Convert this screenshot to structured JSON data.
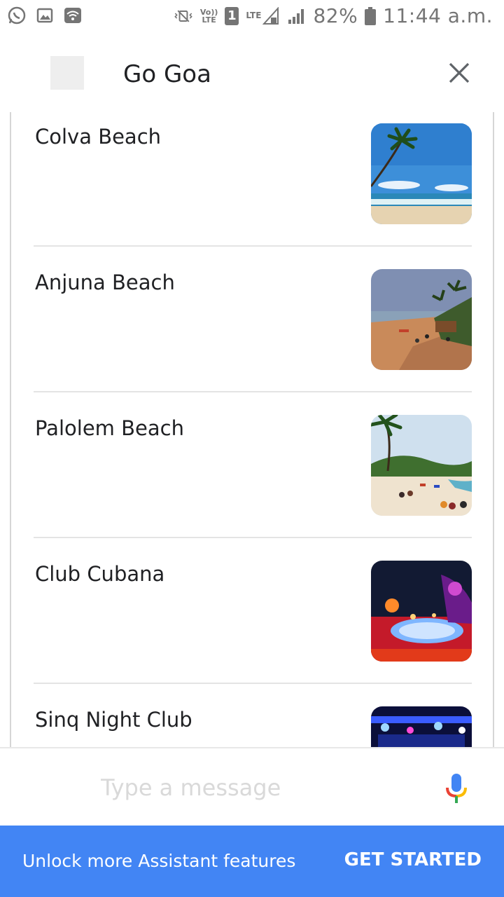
{
  "status_bar": {
    "battery": "82%",
    "time": "11:44 a.m.",
    "volte_top": "Vo))",
    "volte_bottom": "LTE",
    "sim": "1",
    "lte": "LTE",
    "icons_left": [
      "whatsapp-icon",
      "gallery-icon",
      "wifi-icon"
    ],
    "icons_right": [
      "vibrate-icon",
      "volte-icon",
      "sim-icon",
      "lte-icon",
      "signal-icon",
      "battery-icon"
    ]
  },
  "header": {
    "title": "Go Goa"
  },
  "list": {
    "items": [
      {
        "label": "Colva Beach",
        "image": "beach-palm-sea"
      },
      {
        "label": "Anjuna Beach",
        "image": "beach-shacks"
      },
      {
        "label": "Palolem Beach",
        "image": "beach-crowd-palms"
      },
      {
        "label": "Club Cubana",
        "image": "pool-night-club"
      },
      {
        "label": "Sinq Night Club",
        "image": "night-club-lights"
      }
    ]
  },
  "composer": {
    "placeholder": "Type a message",
    "mic_icon": "mic-icon"
  },
  "banner": {
    "text": "Unlock more Assistant features",
    "button": "GET STARTED"
  },
  "colors": {
    "banner_bg": "#4285f4",
    "status_icons": "#757575",
    "divider": "#e4e4e4"
  }
}
